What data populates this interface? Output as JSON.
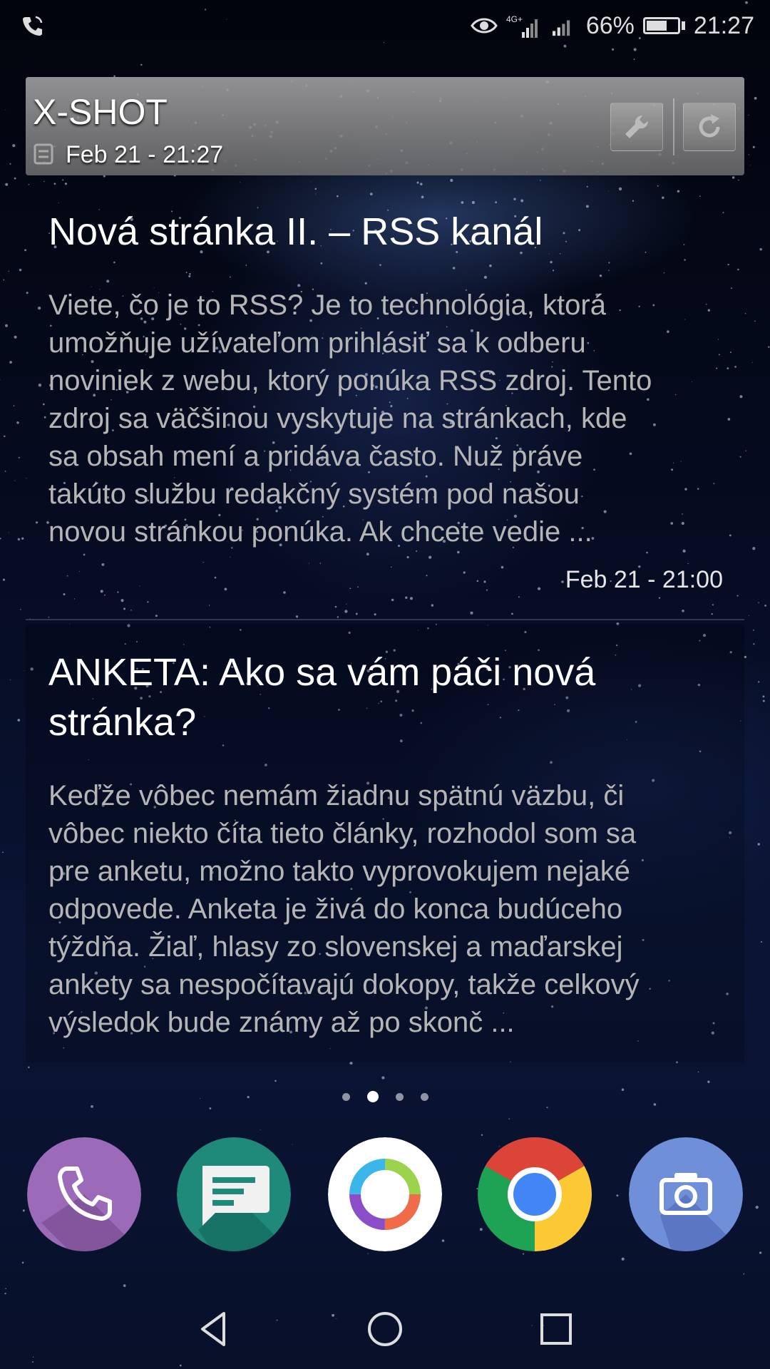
{
  "status_bar": {
    "battery_percent": "66%",
    "battery_level": 0.66,
    "time": "21:27",
    "network": "4G+",
    "icons": [
      "wifi-calling-icon",
      "eye-comfort-icon",
      "signal-4g-icon",
      "signal-icon",
      "battery-icon"
    ]
  },
  "widget": {
    "title": "X-SHOT",
    "last_updated": "Feb 21 - 21:27",
    "buttons": [
      "wrench-icon",
      "refresh-icon"
    ]
  },
  "articles": [
    {
      "title": "Nová stránka II. – RSS kanál",
      "lines": [
        "Viete, čo je to RSS? Je to technológia, ktorá",
        "umožňuje užívateľom prihlásiť sa k odberu",
        "noviniek z webu, ktorý ponúka RSS zdroj. Tento",
        "zdroj sa väčšinou vyskytuje na stránkach, kde",
        "sa obsah mení a pridáva často. Nuž práve",
        "takúto službu redakčný systém pod našou",
        "novou stránkou ponúka. Ak chcete vedie ..."
      ],
      "date": "Feb 21 - 21:00"
    },
    {
      "title_lines": [
        "ANKETA: Ako sa vám páči nová",
        "stránka?"
      ],
      "lines": [
        "Keďže vôbec nemám žiadnu spätnú väzbu, či",
        "vôbec niekto číta tieto články, rozhodol som sa",
        "pre anketu, možno takto vyprovokujem nejaké",
        "odpovede. Anketa je živá do konca budúceho",
        "týždňa. Žiaľ, hlasy zo slovenskej a maďarskej",
        "ankety sa nespočítavajú dokopy, takže celkový",
        "výsledok bude známy až po skonč ..."
      ]
    }
  ],
  "home_pages": {
    "count": 4,
    "active_index": 1
  },
  "dock": [
    "phone-icon",
    "messages-icon",
    "swirl-app-icon",
    "chrome-icon",
    "camera-icon"
  ],
  "dock_colors": {
    "phone": "#9b6ab8",
    "messages": "#1f8a7a",
    "camera": "#6f8fd8"
  },
  "nav": [
    "back-icon",
    "home-icon",
    "recents-icon"
  ]
}
